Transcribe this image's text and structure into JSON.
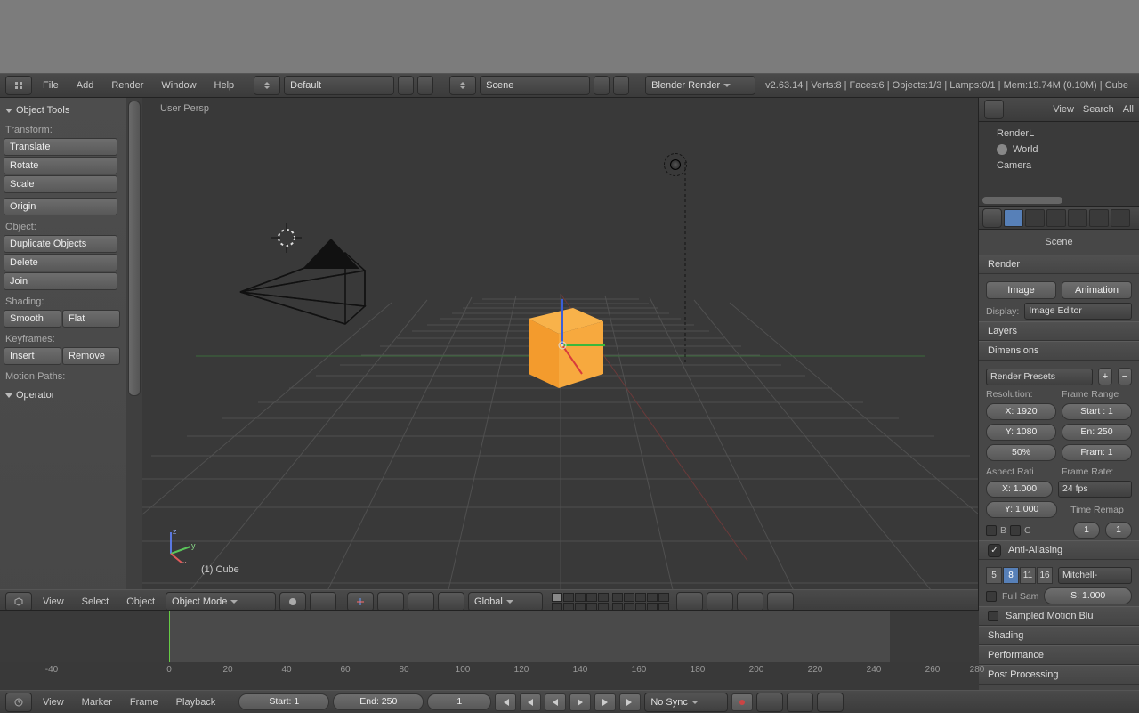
{
  "menubar": {
    "file": "File",
    "add": "Add",
    "render": "Render",
    "window": "Window",
    "help": "Help",
    "layout": "Default",
    "scene": "Scene",
    "engine": "Blender Render"
  },
  "stats": "v2.63.14 | Verts:8 | Faces:6 | Objects:1/3 | Lamps:0/1 | Mem:19.74M (0.10M) | Cube",
  "tools": {
    "title": "Object Tools",
    "transform": "Transform:",
    "translate": "Translate",
    "rotate": "Rotate",
    "scale": "Scale",
    "origin": "Origin",
    "object": "Object:",
    "dup": "Duplicate Objects",
    "delete": "Delete",
    "join": "Join",
    "shading": "Shading:",
    "smooth": "Smooth",
    "flat": "Flat",
    "keyframes": "Keyframes:",
    "insert": "Insert",
    "remove": "Remove",
    "motion": "Motion Paths:",
    "operator": "Operator"
  },
  "viewport": {
    "mode": "User Persp",
    "object": "(1) Cube"
  },
  "view3dheader": {
    "view": "View",
    "select": "Select",
    "object": "Object",
    "mode": "Object Mode",
    "orient": "Global"
  },
  "outliner": {
    "view": "View",
    "search": "Search",
    "all": "All",
    "renderlayers": "RenderL",
    "world": "World",
    "camera": "Camera"
  },
  "props": {
    "scene": "Scene",
    "render_hd": "Render",
    "image": "Image",
    "anim": "Animation",
    "display": "Display:",
    "display_val": "Image Editor",
    "layers_hd": "Layers",
    "dim_hd": "Dimensions",
    "presets": "Render Presets",
    "res": "Resolution:",
    "resx": "X: 1920",
    "resy": "Y: 1080",
    "respct": "50%",
    "frame": "Frame Range",
    "fstart": "Start : 1",
    "fend": "En: 250",
    "fstep": "Fram: 1",
    "aspect": "Aspect Rati",
    "ax": "X: 1.000",
    "ay": "Y: 1.000",
    "frate": "Frame Rate:",
    "fps": "24 fps",
    "remap": "Time Remap",
    "r1": "1",
    "r2": "1",
    "border_b": "B",
    "border_c": "C",
    "aa_hd": "Anti-Aliasing",
    "aa": [
      "5",
      "8",
      "11",
      "16"
    ],
    "aa_filter": "Mitchell-",
    "fullsam": "Full Sam",
    "size": "S: 1.000",
    "smb": "Sampled Motion Blu",
    "shading": "Shading",
    "perf": "Performance",
    "post": "Post Processing"
  },
  "timeline": {
    "ticks": [
      "-40",
      "0",
      "20",
      "40",
      "60",
      "80",
      "100",
      "120",
      "140",
      "160",
      "180",
      "200",
      "220",
      "240",
      "260",
      "280"
    ],
    "view": "View",
    "marker": "Marker",
    "frame": "Frame",
    "playback": "Playback",
    "start": "Start: 1",
    "end": "End: 250",
    "cur": "1",
    "sync": "No Sync"
  }
}
